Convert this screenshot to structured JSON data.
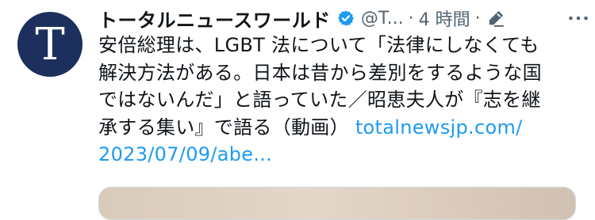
{
  "account": {
    "avatar_letter": "T",
    "display_name": "トータルニュースワールド",
    "handle": "@T...",
    "separator": "·",
    "time": "4 時間",
    "verified_icon": "verified-badge-icon",
    "edit_icon": "edit-pencil-icon",
    "more_icon": "more-dots-icon"
  },
  "tweet": {
    "line1": "安倍総理は、LGBT 法について「法律にしなくても",
    "line2": "解決方法がある。日本は昔から差別をするような国",
    "line3": "ではないんだ」と語っていた／昭恵夫人が『志を継",
    "line4_text": "承する集い』で語る（動画）",
    "line4_link": "totalnewsjp.com/",
    "line5_link": "2023/07/09/abe..."
  },
  "colors": {
    "avatar_bg": "#1d2f5c",
    "link": "#1d9bf0",
    "verified": "#1d9bf0",
    "muted": "#536471"
  }
}
